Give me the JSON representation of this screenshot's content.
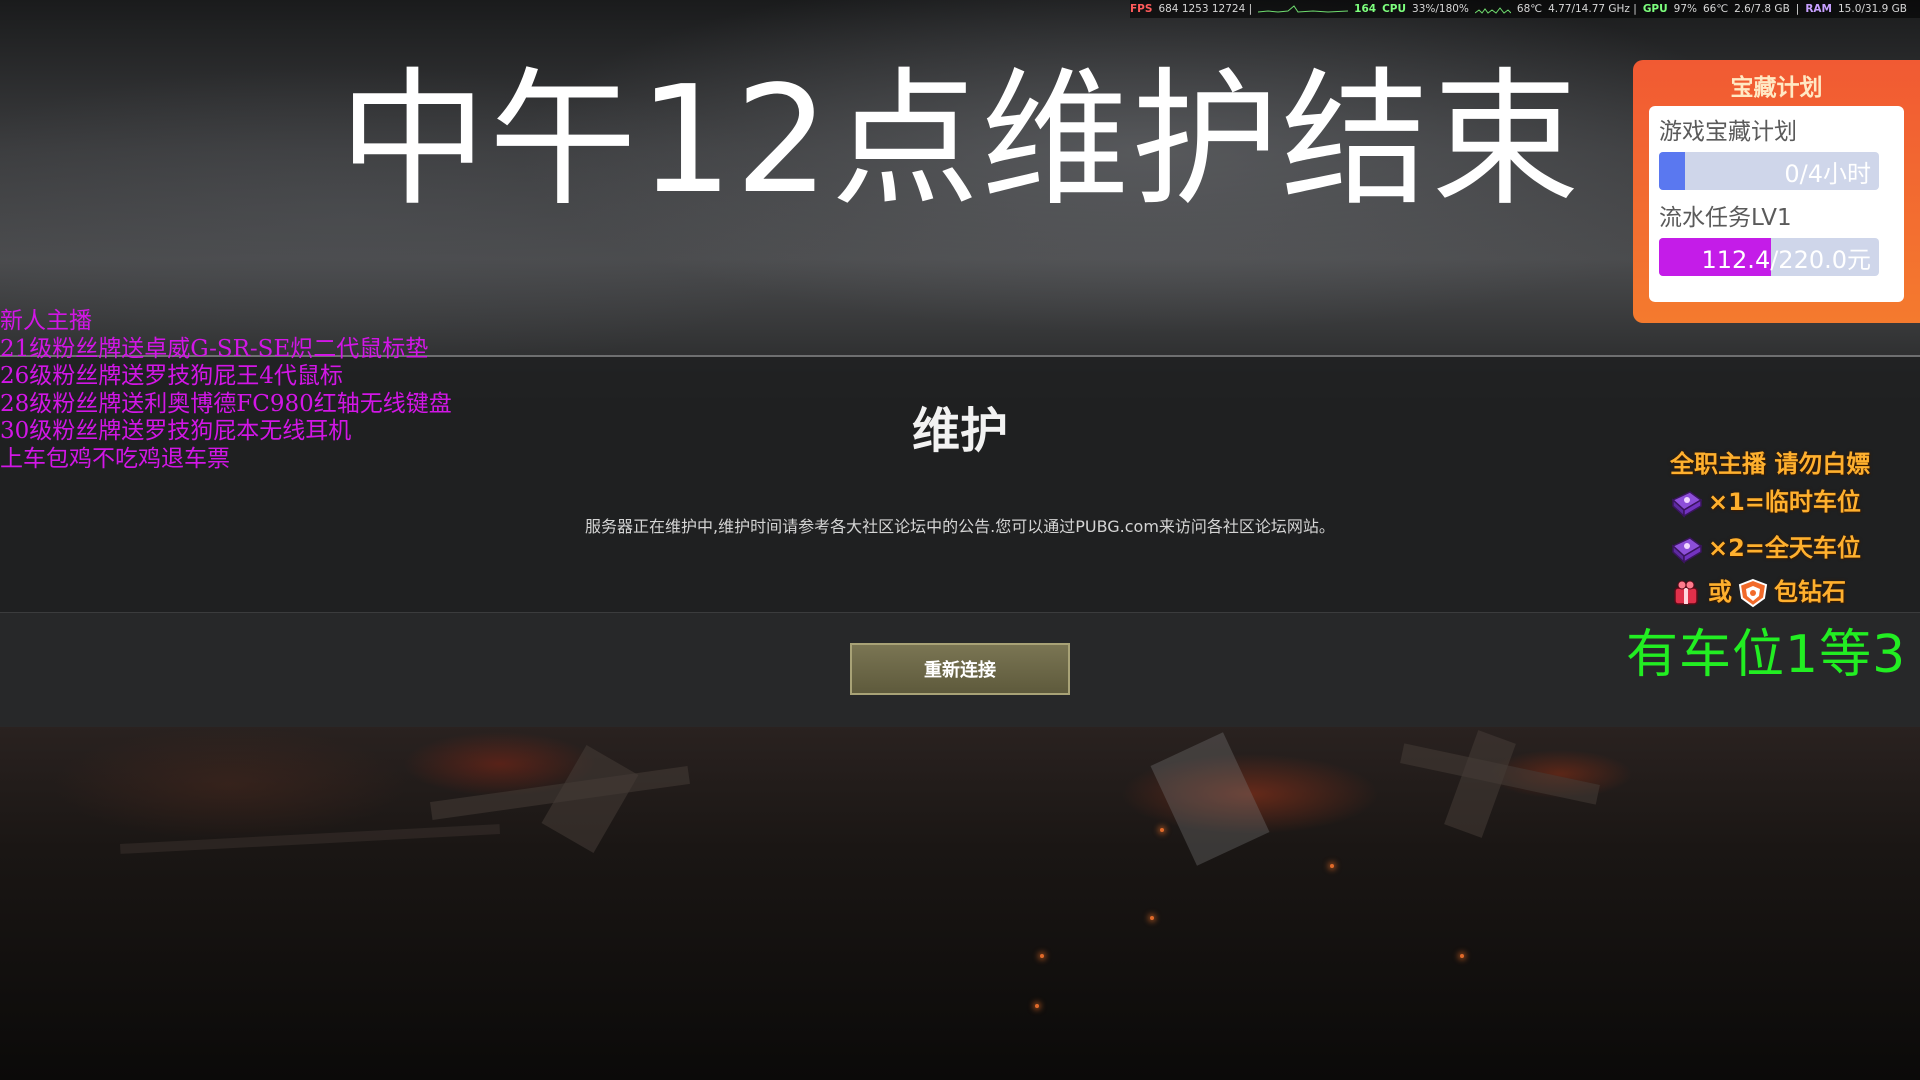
{
  "perf_overlay": {
    "fps_label": "FPS",
    "fps_values": "684 1253 12724 |",
    "fps_graph_value": "164",
    "cpu_label": "CPU",
    "cpu_value": "33%/180%",
    "cpu_temp": "68℃",
    "cpu_freq": "4.77/14.77 GHz |",
    "gpu_label": "GPU",
    "gpu_value": "97%",
    "gpu_temp": "66℃",
    "gpu_mem": "2.6/7.8 GB",
    "separator": "|",
    "ram_label": "RAM",
    "ram_value": "15.0/31.9 GB"
  },
  "title": "中午12点维护结束",
  "maintenance": {
    "heading": "维护",
    "message": "服务器正在维护中,维护时间请参考各大社区论坛中的公告.您可以通过PUBG.com来访问各社区论坛网站。",
    "reconnect_label": "重新连接"
  },
  "left_overlay": {
    "lines": [
      "新人主播",
      "21级粉丝牌送卓威G-SR-SE炽二代鼠标垫",
      "26级粉丝牌送罗技狗屁王4代鼠标",
      "28级粉丝牌送利奥博德FC980红轴无线键盘",
      "30级粉丝牌送罗技狗屁本无线耳机",
      "上车包鸡不吃鸡退车票"
    ],
    "color": "#d216e6"
  },
  "treasure_widget": {
    "title": "宝藏计划",
    "plan_label": "游戏宝藏计划",
    "plan_progress_text": "0/4小时",
    "plan_progress_fraction": 0.0,
    "task_label": "流水任务LV1",
    "task_progress_text": "112.4/220.0元",
    "task_progress_fraction": 0.511,
    "accent_color": "#f15a33",
    "plan_fill_color": "#5a78f0",
    "task_fill_color": "#c41ce8"
  },
  "promo": {
    "line1": "全职主播  请勿白嫖",
    "line2": "×1=临时车位",
    "line3": "×2=全天车位",
    "line4_or": "或",
    "line4_rest": "包钻石",
    "green_text": "有车位1等3",
    "icons": [
      "purple-gift-icon",
      "purple-gift-icon",
      "red-gift-icon",
      "guard-shield-icon"
    ],
    "orange_color": "#ffb02e",
    "green_color": "#22ee22"
  }
}
